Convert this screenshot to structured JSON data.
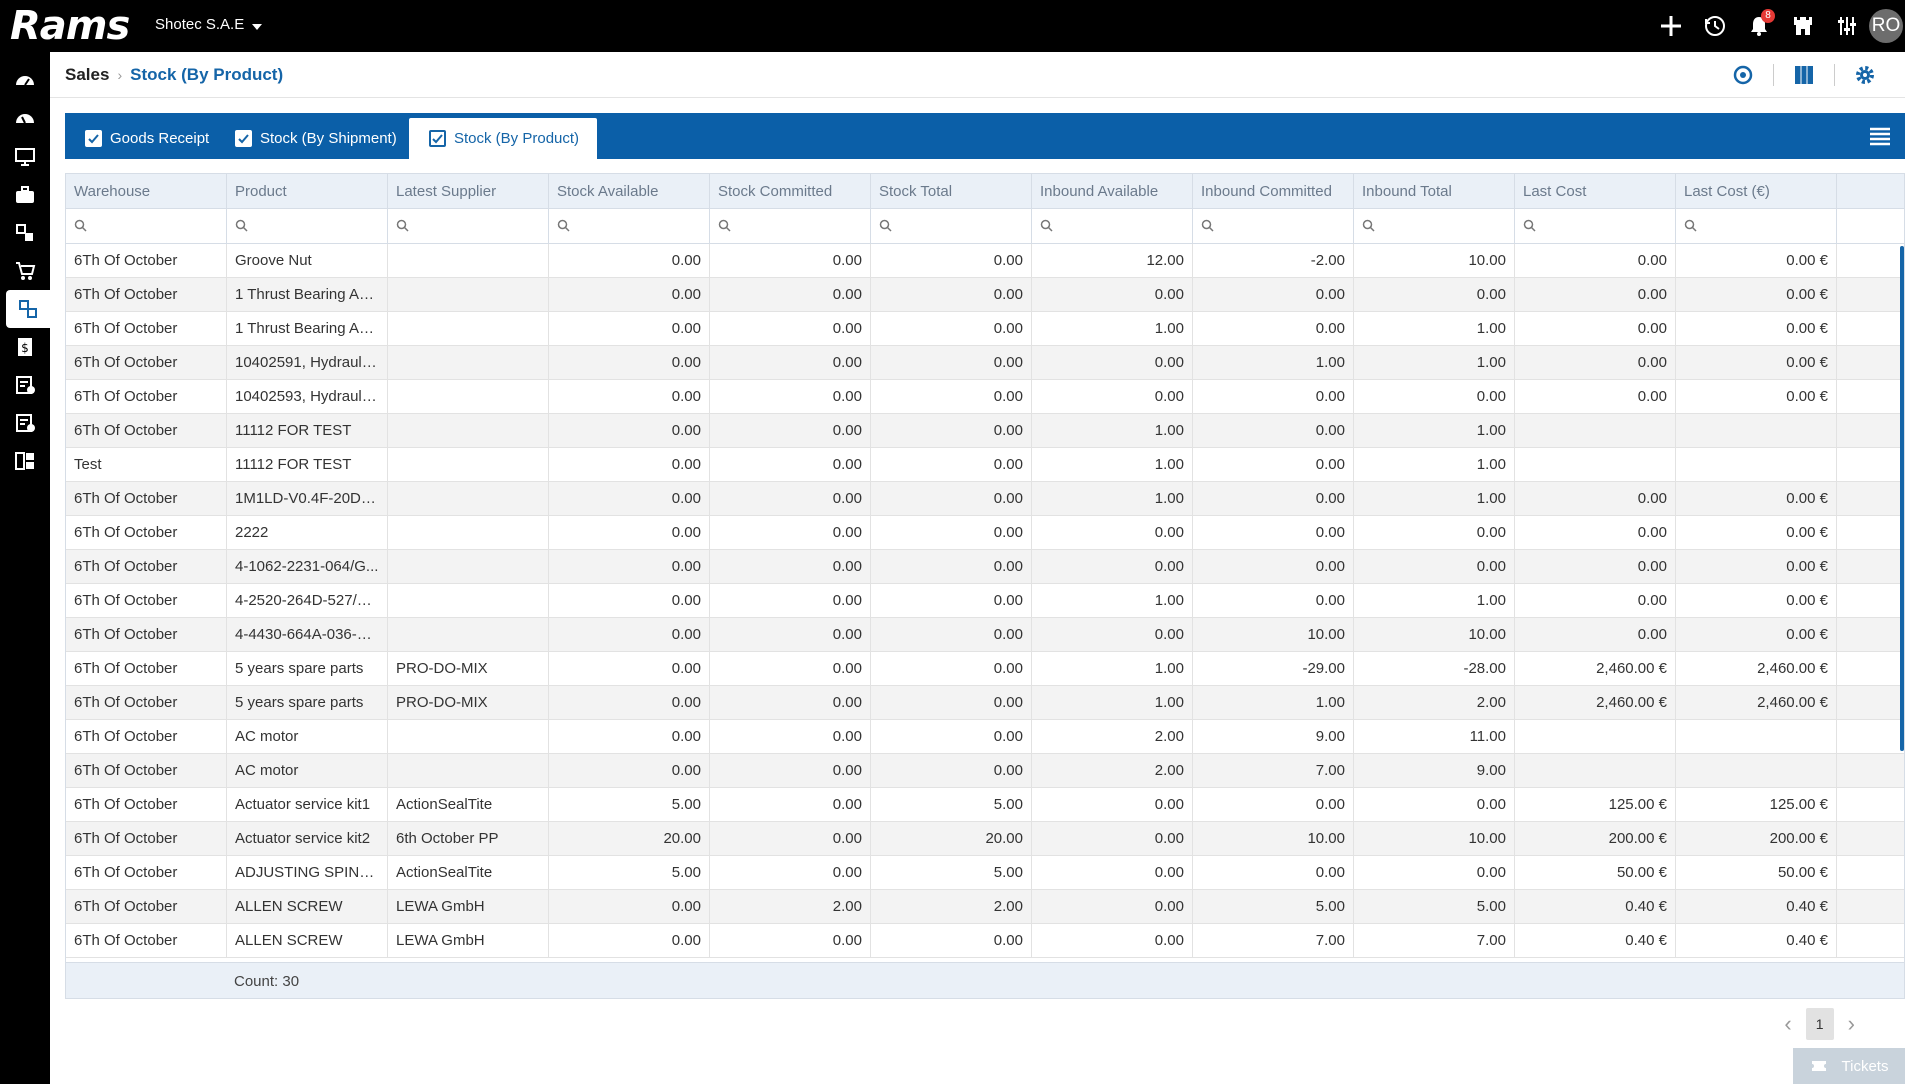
{
  "app": {
    "logo_text": "Rams",
    "company": "Shotec S.A.E"
  },
  "topbar": {
    "icons": [
      "plus-icon",
      "history-icon",
      "bell-icon",
      "castle-icon",
      "sliders-icon"
    ],
    "notifications_count": "8",
    "avatar_initials": "RO"
  },
  "sidebar": {
    "items": [
      "dashboard-icon",
      "speedometer-icon",
      "monitor-icon",
      "briefcase-icon",
      "modules-icon",
      "cart-icon",
      "stock-icon",
      "invoice-icon",
      "checklist-icon",
      "report-icon",
      "grid-icon"
    ],
    "active_index": 6
  },
  "breadcrumb": {
    "root": "Sales",
    "current": "Stock (By Product)"
  },
  "tabs": [
    {
      "label": "Goods Receipt",
      "checked": true
    },
    {
      "label": "Stock (By Shipment)",
      "checked": true
    },
    {
      "label": "Stock (By Product)",
      "checked": true,
      "active": true
    }
  ],
  "grid": {
    "columns": [
      "Warehouse",
      "Product",
      "Latest Supplier",
      "Stock Available",
      "Stock Committed",
      "Stock Total",
      "Inbound Available",
      "Inbound Committed",
      "Inbound Total",
      "Last Cost",
      "Last Cost (€)"
    ],
    "rows": [
      [
        "6Th Of October",
        "Groove Nut",
        "",
        "0.00",
        "0.00",
        "0.00",
        "12.00",
        "-2.00",
        "10.00",
        "0.00",
        "0.00 €"
      ],
      [
        "6Th Of October",
        "1 Thrust Bearing Ass...",
        "",
        "0.00",
        "0.00",
        "0.00",
        "0.00",
        "0.00",
        "0.00",
        "0.00",
        "0.00 €"
      ],
      [
        "6Th Of October",
        "1 Thrust Bearing Ass...",
        "",
        "0.00",
        "0.00",
        "0.00",
        "1.00",
        "0.00",
        "1.00",
        "0.00",
        "0.00 €"
      ],
      [
        "6Th Of October",
        "10402591, Hydraulic...",
        "",
        "0.00",
        "0.00",
        "0.00",
        "0.00",
        "1.00",
        "1.00",
        "0.00",
        "0.00 €"
      ],
      [
        "6Th Of October",
        "10402593, Hydraulic...",
        "",
        "0.00",
        "0.00",
        "0.00",
        "0.00",
        "0.00",
        "0.00",
        "0.00",
        "0.00 €"
      ],
      [
        "6Th Of October",
        "11112 FOR TEST",
        "",
        "0.00",
        "0.00",
        "0.00",
        "1.00",
        "0.00",
        "1.00",
        "",
        ""
      ],
      [
        "Test",
        "11112 FOR TEST",
        "",
        "0.00",
        "0.00",
        "0.00",
        "1.00",
        "0.00",
        "1.00",
        "",
        ""
      ],
      [
        "6Th Of October",
        "1M1LD-V0.4F-20D1R...",
        "",
        "0.00",
        "0.00",
        "0.00",
        "1.00",
        "0.00",
        "1.00",
        "0.00",
        "0.00 €"
      ],
      [
        "6Th Of October",
        "2222",
        "",
        "0.00",
        "0.00",
        "0.00",
        "0.00",
        "0.00",
        "0.00",
        "0.00",
        "0.00 €"
      ],
      [
        "6Th Of October",
        "4-1062-2231-064/G...",
        "",
        "0.00",
        "0.00",
        "0.00",
        "0.00",
        "0.00",
        "0.00",
        "0.00",
        "0.00 €"
      ],
      [
        "6Th Of October",
        "4-2520-264D-527/KK...",
        "",
        "0.00",
        "0.00",
        "0.00",
        "1.00",
        "0.00",
        "1.00",
        "0.00",
        "0.00 €"
      ],
      [
        "6Th Of October",
        "4-4430-664A-036-1/...",
        "",
        "0.00",
        "0.00",
        "0.00",
        "0.00",
        "10.00",
        "10.00",
        "0.00",
        "0.00 €"
      ],
      [
        "6Th Of October",
        "5 years spare parts",
        "PRO-DO-MIX",
        "0.00",
        "0.00",
        "0.00",
        "1.00",
        "-29.00",
        "-28.00",
        "2,460.00 €",
        "2,460.00 €"
      ],
      [
        "6Th Of October",
        "5 years spare parts",
        "PRO-DO-MIX",
        "0.00",
        "0.00",
        "0.00",
        "1.00",
        "1.00",
        "2.00",
        "2,460.00 €",
        "2,460.00 €"
      ],
      [
        "6Th Of October",
        "AC motor",
        "",
        "0.00",
        "0.00",
        "0.00",
        "2.00",
        "9.00",
        "11.00",
        "",
        ""
      ],
      [
        "6Th Of October",
        "AC motor",
        "",
        "0.00",
        "0.00",
        "0.00",
        "2.00",
        "7.00",
        "9.00",
        "",
        ""
      ],
      [
        "6Th Of October",
        "Actuator service kit1",
        "ActionSealTite",
        "5.00",
        "0.00",
        "5.00",
        "0.00",
        "0.00",
        "0.00",
        "125.00 €",
        "125.00 €"
      ],
      [
        "6Th Of October",
        "Actuator service kit2",
        "6th October PP",
        "20.00",
        "0.00",
        "20.00",
        "0.00",
        "10.00",
        "10.00",
        "200.00 €",
        "200.00 €"
      ],
      [
        "6Th Of October",
        "ADJUSTING SPINDLE",
        "ActionSealTite",
        "5.00",
        "0.00",
        "5.00",
        "0.00",
        "0.00",
        "0.00",
        "50.00 €",
        "50.00 €"
      ],
      [
        "6Th Of October",
        "ALLEN SCREW",
        "LEWA GmbH",
        "0.00",
        "2.00",
        "2.00",
        "0.00",
        "5.00",
        "5.00",
        "0.40 €",
        "0.40 €"
      ],
      [
        "6Th Of October",
        "ALLEN SCREW",
        "LEWA GmbH",
        "0.00",
        "0.00",
        "0.00",
        "0.00",
        "7.00",
        "7.00",
        "0.40 €",
        "0.40 €"
      ]
    ],
    "count_label": "Count: 30"
  },
  "pager": {
    "current_page": "1"
  },
  "tickets": {
    "label": "Tickets"
  },
  "colors": {
    "accent": "#1565a8",
    "tabbar": "#0b5fa8",
    "badge": "#e53935"
  }
}
